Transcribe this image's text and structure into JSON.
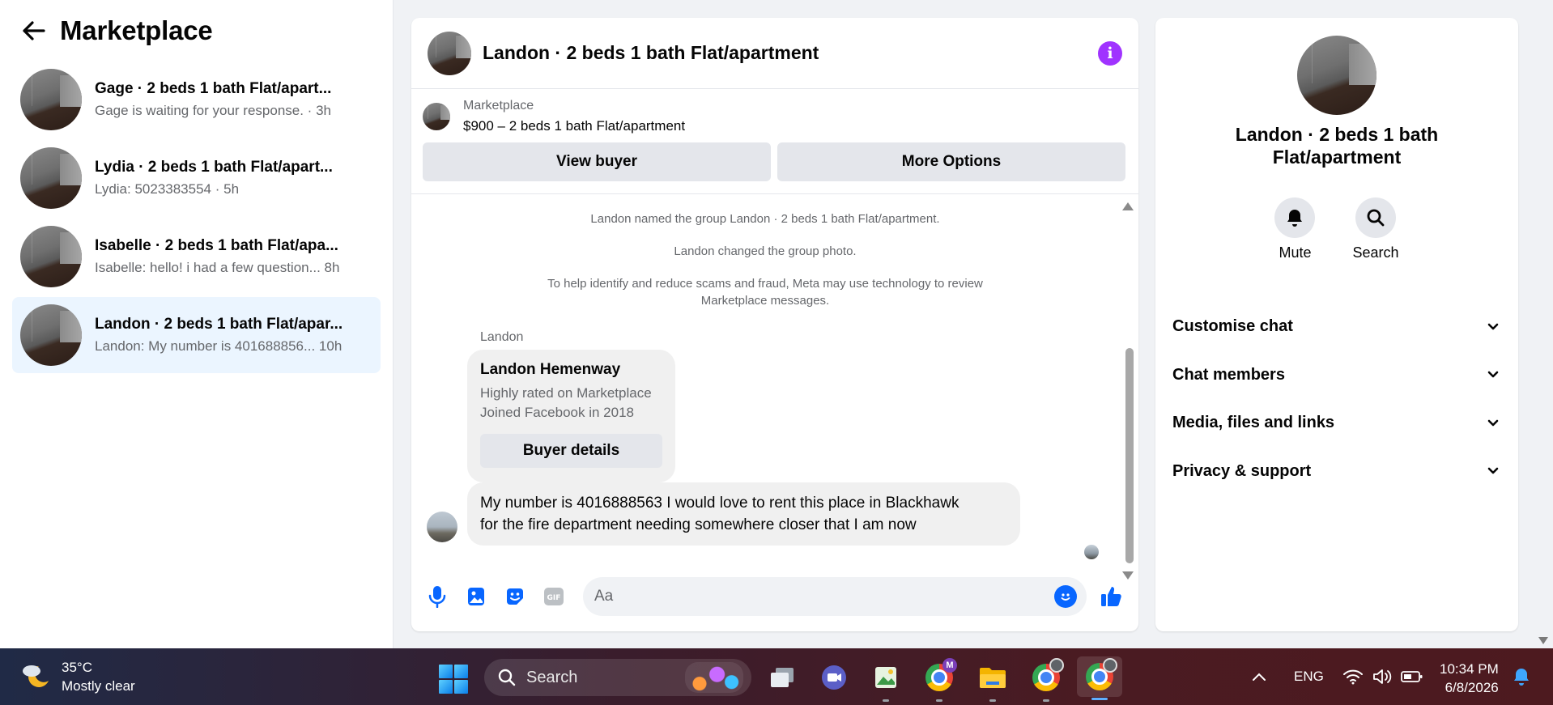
{
  "sidebar": {
    "title": "Marketplace",
    "conversations": [
      {
        "name": "Gage · 2 beds 1 bath Flat/apart...",
        "preview": "Gage is waiting for your response. · 3h"
      },
      {
        "name": "Lydia · 2 beds 1 bath Flat/apart...",
        "preview": "Lydia: 5023383554 · 5h"
      },
      {
        "name": "Isabelle · 2 beds 1 bath Flat/apa...",
        "preview": "Isabelle: hello! i had a few question... 8h"
      },
      {
        "name": "Landon · 2 beds 1 bath Flat/apar...",
        "preview": "Landon: My number is 401688856... 10h"
      }
    ]
  },
  "chat": {
    "title": "Landon · 2 beds 1 bath Flat/apartment",
    "listing": {
      "source": "Marketplace",
      "price_title": "$900 – 2 beds 1 bath Flat/apartment",
      "view_buyer": "View buyer",
      "more_options": "More Options"
    },
    "system_messages": [
      "Landon named the group Landon · 2 beds 1 bath Flat/apartment.",
      "Landon changed the group photo.",
      "To help identify and reduce scams and fraud, Meta may use technology to review",
      "Marketplace messages."
    ],
    "sender": "Landon",
    "buyer_card": {
      "name": "Landon Hemenway",
      "line1": "Highly rated on Marketplace",
      "line2": "Joined Facebook in 2018",
      "button": "Buyer details"
    },
    "message_line1": "My number is 4016888563 I would love to rent this place in Blackhawk",
    "message_line2": "for the fire department needing somewhere closer that I am now",
    "composer_placeholder": "Aa"
  },
  "details": {
    "title_line1": "Landon · 2 beds 1 bath",
    "title_line2": "Flat/apartment",
    "actions": {
      "mute": "Mute",
      "search": "Search"
    },
    "sections": [
      "Customise chat",
      "Chat members",
      "Media, files and links",
      "Privacy & support"
    ]
  },
  "taskbar": {
    "temperature": "35°C",
    "weather": "Mostly clear",
    "search_label": "Search",
    "language": "ENG",
    "time": "10:34 PM",
    "date": "6/8/2026"
  },
  "colors": {
    "accent": "#0866ff",
    "info": "#a033ff",
    "active_conversation": "#ebf5ff"
  }
}
